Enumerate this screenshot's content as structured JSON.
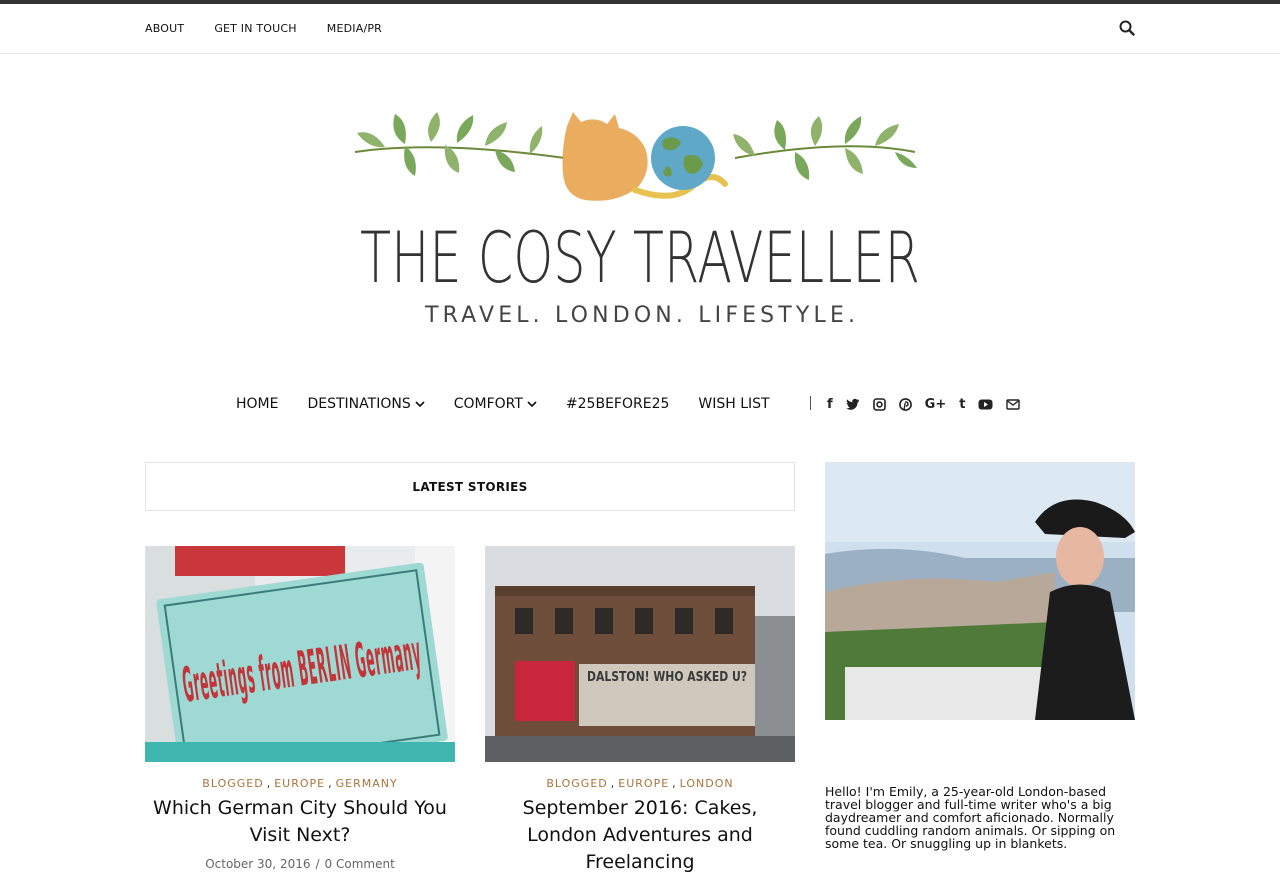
{
  "topbar": {
    "links": [
      "ABOUT",
      "GET IN TOUCH",
      "MEDIA/PR"
    ],
    "search_icon": "search-icon"
  },
  "brand": {
    "title": "THE COSY TRAVELLER",
    "tagline": "TRAVEL. LONDON. LIFESTYLE."
  },
  "mainnav": {
    "items": [
      {
        "label": "HOME",
        "has_dropdown": false
      },
      {
        "label": "DESTINATIONS",
        "has_dropdown": true
      },
      {
        "label": "COMFORT",
        "has_dropdown": true
      },
      {
        "label": "#25BEFORE25",
        "has_dropdown": false
      },
      {
        "label": "WISH LIST",
        "has_dropdown": false
      }
    ],
    "socials": [
      "f",
      "twitter-icon",
      "instagram-icon",
      "pinterest-icon",
      "G+",
      "t",
      "youtube-icon",
      "email-icon"
    ]
  },
  "section": {
    "title": "LATEST STORIES"
  },
  "posts": [
    {
      "image_text": "Greetings from BERLIN Germany",
      "categories": [
        "BLOGGED",
        "EUROPE",
        "GERMANY"
      ],
      "title": "Which German City Should You Visit Next?",
      "date": "October 30, 2016",
      "comments": "0 Comment"
    },
    {
      "image_text": "DALSTON! WHO ASKED U?",
      "categories": [
        "BLOGGED",
        "EUROPE",
        "LONDON"
      ],
      "title": "September 2016: Cakes, London Adventures and Freelancing"
    }
  ],
  "sidebar": {
    "bio": "Hello! I'm Emily, a 25-year-old London-based travel blogger and full-time writer who's a big daydreamer and comfort aficionado. Normally found cuddling random animals. Or sipping on some tea. Or snuggling up in blankets."
  },
  "colors": {
    "accent": "#a8743c",
    "text": "#111111",
    "border": "#e3e3e3"
  }
}
